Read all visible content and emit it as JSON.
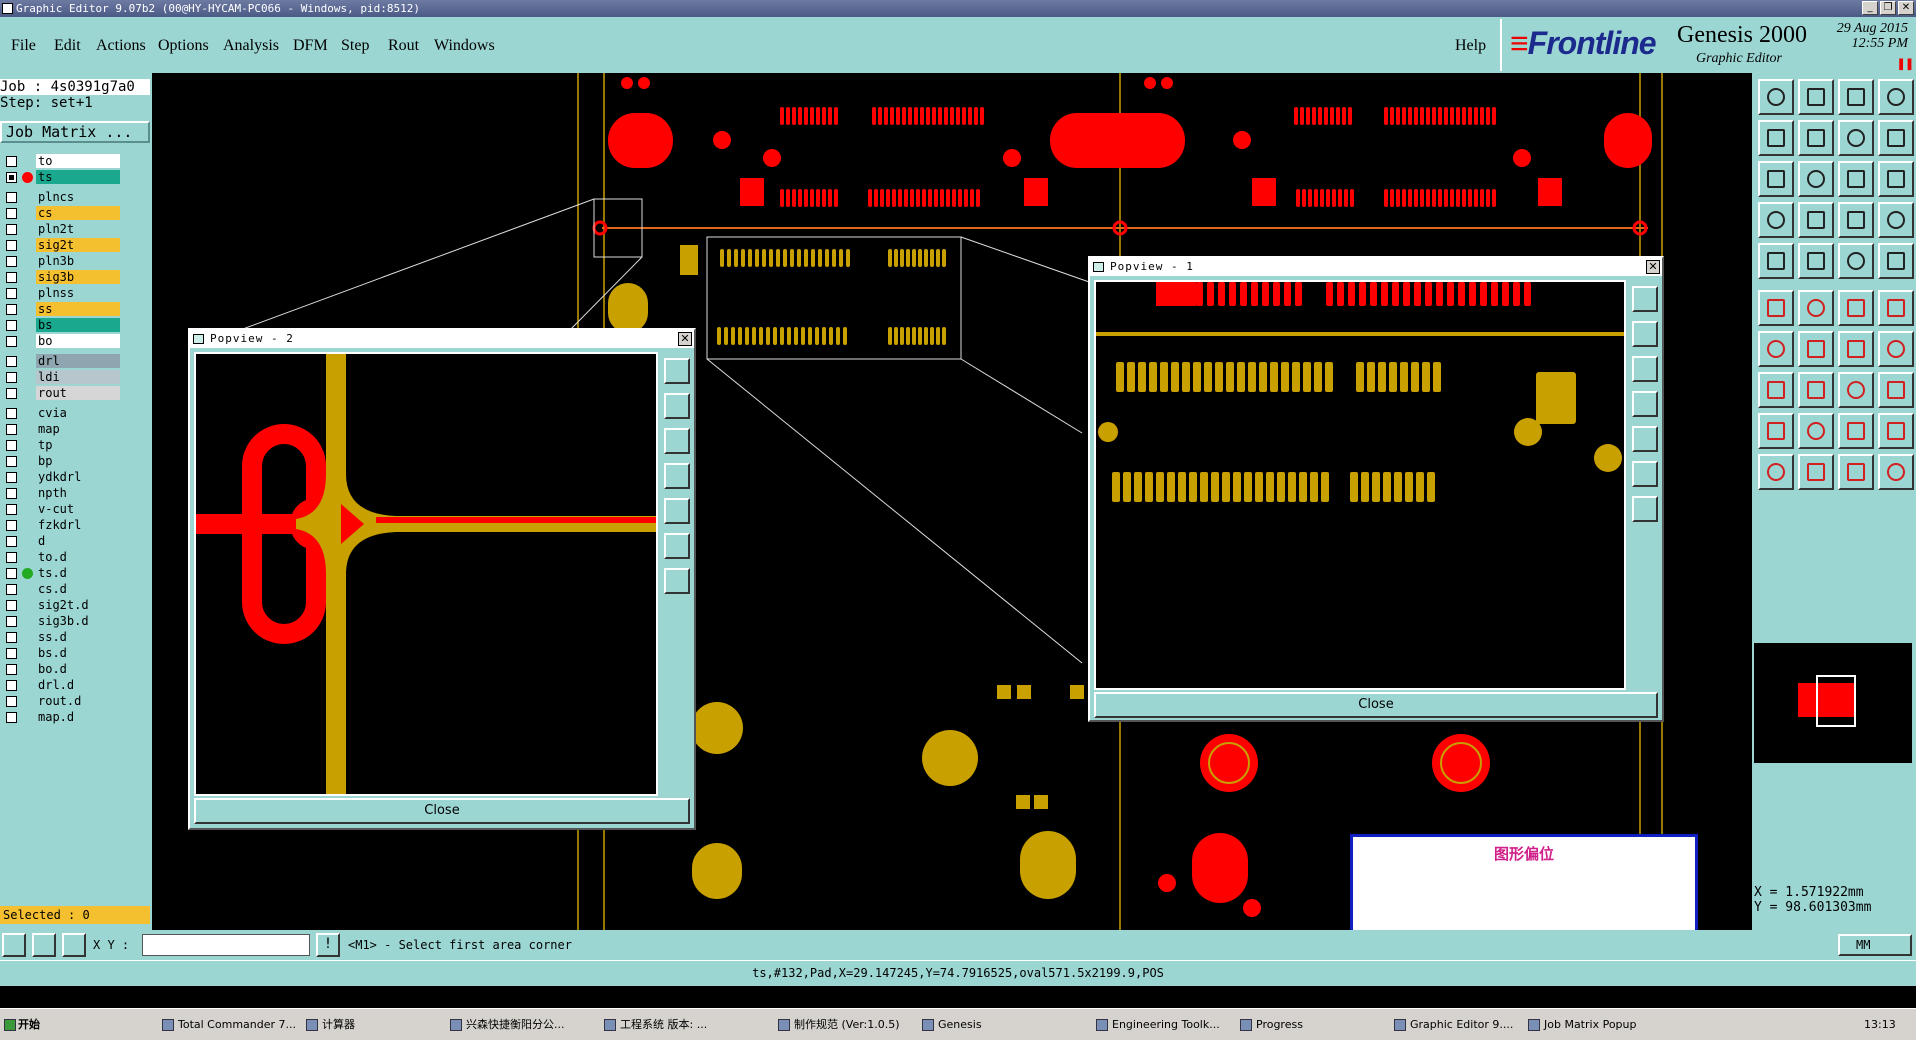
{
  "window": {
    "title": "Graphic Editor 9.07b2 (00@HY-HYCAM-PC066 - Windows, pid:8512)"
  },
  "menu": {
    "items": [
      "File",
      "Edit",
      "Actions",
      "Options",
      "Analysis",
      "DFM",
      "Step",
      "Rout",
      "Windows"
    ],
    "help": "Help"
  },
  "brand": {
    "name": "Frontline",
    "product": "Genesis 2000",
    "subtitle": "Graphic Editor",
    "date": "29 Aug 2015",
    "time": "12:55 PM"
  },
  "job": {
    "job_line": "Job : 4s0391g7a0",
    "step_line": "Step: set+1",
    "matrix_button": "Job Matrix ..."
  },
  "layers": [
    {
      "name": "to",
      "bg": "#ffffff",
      "checked": false,
      "dot": ""
    },
    {
      "name": "ts",
      "bg": "#1aa88e",
      "checked": true,
      "dot": "#ff0000",
      "extra": "o"
    },
    {
      "name": "plncs",
      "bg": "#9cd6d3",
      "checked": false,
      "dot": ""
    },
    {
      "name": "cs",
      "bg": "#f5c030",
      "checked": false,
      "dot": ""
    },
    {
      "name": "pln2t",
      "bg": "#9cd6d3",
      "checked": false,
      "dot": ""
    },
    {
      "name": "sig2t",
      "bg": "#f5c030",
      "checked": false,
      "dot": ""
    },
    {
      "name": "pln3b",
      "bg": "#9cd6d3",
      "checked": false,
      "dot": ""
    },
    {
      "name": "sig3b",
      "bg": "#f5c030",
      "checked": false,
      "dot": ""
    },
    {
      "name": "plnss",
      "bg": "#9cd6d3",
      "checked": false,
      "dot": ""
    },
    {
      "name": "ss",
      "bg": "#f5c030",
      "checked": false,
      "dot": ""
    },
    {
      "name": "bs",
      "bg": "#1aa88e",
      "checked": false,
      "dot": ""
    },
    {
      "name": "bo",
      "bg": "#ffffff",
      "checked": false,
      "dot": ""
    },
    {
      "name": "drl",
      "bg": "#8fa6b0",
      "checked": false,
      "dot": ""
    },
    {
      "name": "ldi",
      "bg": "#b6c6cc",
      "checked": false,
      "dot": ""
    },
    {
      "name": "rout",
      "bg": "#d6d6d6",
      "checked": false,
      "dot": ""
    },
    {
      "name": "cvia",
      "bg": "#9cd6d3",
      "checked": false,
      "dot": ""
    },
    {
      "name": "map",
      "bg": "#9cd6d3",
      "checked": false,
      "dot": ""
    },
    {
      "name": "tp",
      "bg": "#9cd6d3",
      "checked": false,
      "dot": ""
    },
    {
      "name": "bp",
      "bg": "#9cd6d3",
      "checked": false,
      "dot": ""
    },
    {
      "name": "ydkdrl",
      "bg": "#9cd6d3",
      "checked": false,
      "dot": ""
    },
    {
      "name": "npth",
      "bg": "#9cd6d3",
      "checked": false,
      "dot": ""
    },
    {
      "name": "v-cut",
      "bg": "#9cd6d3",
      "checked": false,
      "dot": ""
    },
    {
      "name": "fzkdrl",
      "bg": "#9cd6d3",
      "checked": false,
      "dot": ""
    },
    {
      "name": "d",
      "bg": "#9cd6d3",
      "checked": false,
      "dot": ""
    },
    {
      "name": "to.d",
      "bg": "#9cd6d3",
      "checked": false,
      "dot": ""
    },
    {
      "name": "ts.d",
      "bg": "#9cd6d3",
      "checked": false,
      "dot": "#22aa22"
    },
    {
      "name": "cs.d",
      "bg": "#9cd6d3",
      "checked": false,
      "dot": ""
    },
    {
      "name": "sig2t.d",
      "bg": "#9cd6d3",
      "checked": false,
      "dot": ""
    },
    {
      "name": "sig3b.d",
      "bg": "#9cd6d3",
      "checked": false,
      "dot": ""
    },
    {
      "name": "ss.d",
      "bg": "#9cd6d3",
      "checked": false,
      "dot": ""
    },
    {
      "name": "bs.d",
      "bg": "#9cd6d3",
      "checked": false,
      "dot": ""
    },
    {
      "name": "bo.d",
      "bg": "#9cd6d3",
      "checked": false,
      "dot": ""
    },
    {
      "name": "drl.d",
      "bg": "#9cd6d3",
      "checked": false,
      "dot": ""
    },
    {
      "name": "rout.d",
      "bg": "#9cd6d3",
      "checked": false,
      "dot": ""
    },
    {
      "name": "map.d",
      "bg": "#9cd6d3",
      "checked": false,
      "dot": ""
    }
  ],
  "selected": "Selected : 0",
  "coords": {
    "x": "X = 1.571922mm",
    "y": "Y = 98.601303mm"
  },
  "cmd": {
    "xy_label": "X Y :",
    "xy_value": "",
    "prompt": "<M1> - Select first area corner",
    "units": "MM"
  },
  "status": {
    "feature": "ts,#132,Pad,X=29.147245,Y=74.7916525,oval571.5x2199.9,POS"
  },
  "popup1": {
    "title": "Popview - 1",
    "close": "Close"
  },
  "popup2": {
    "title": "Popview - 2",
    "close": "Close"
  },
  "offset_box": {
    "text": "图形偏位"
  },
  "taskbar": {
    "start": "开始",
    "tasks": [
      "Total Commander 7...",
      "计算器",
      "兴森快捷衡阳分公...",
      "工程系统   版本: ...",
      "制作规范 (Ver:1.0.5)",
      "Genesis",
      "Engineering Toolk...",
      "Progress",
      "Graphic Editor 9....",
      "Job Matrix Popup"
    ],
    "clock": "13:13"
  },
  "colors": {
    "panel": "#9cd6d3",
    "red": "#ff0000",
    "gold": "#c8a000",
    "accent": "#1aa88e"
  }
}
